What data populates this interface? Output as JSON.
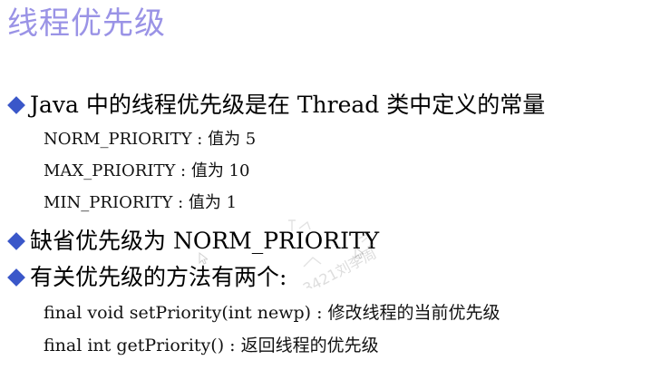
{
  "slide": {
    "title": "线程优先级",
    "bullets": [
      {
        "text": "Java 中的线程优先级是在 Thread 类中定义的常量",
        "items": [
          "NORM_PRIORITY : 值为 5",
          "MAX_PRIORITY : 值为 10",
          "MIN_PRIORITY : 值为 1"
        ]
      },
      {
        "text": "缺省优先级为 NORM_PRIORITY",
        "items": []
      },
      {
        "text": "有关优先级的方法有两个:",
        "items": [
          "final void setPriority(int newp) : 修改线程的当前优先级",
          "final int getPriority() : 返回线程的优先级"
        ]
      }
    ],
    "watermark": "3421刘李周"
  },
  "colors": {
    "title": "#9a93e6",
    "bullet_marker": "#3a57c9",
    "text": "#000000"
  },
  "icons": {
    "bullet_marker": "blue-diamond",
    "watermark": "faint-user-watermark"
  }
}
